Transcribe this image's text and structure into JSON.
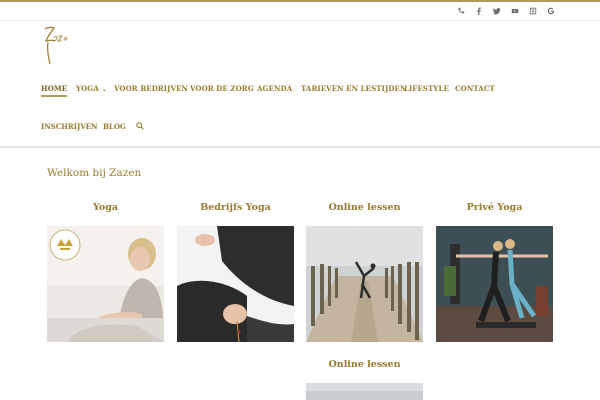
{
  "header": {
    "social_icons": [
      "phone-icon",
      "facebook-icon",
      "twitter-icon",
      "youtube-icon",
      "instagram-icon",
      "google-icon"
    ],
    "accent_color": "#b6985d",
    "logo_text": "Zazen"
  },
  "nav": {
    "items": [
      {
        "label": "HOME",
        "active": true
      },
      {
        "label": "YOGA",
        "has_dropdown": true
      },
      {
        "label": "VOOR BEDRIJVEN"
      },
      {
        "label": "VOOR DE ZORG"
      },
      {
        "label": "AGENDA"
      },
      {
        "label": "TARIEVEN EN LESTIJDEN"
      },
      {
        "label": "LIFESTYLE"
      },
      {
        "label": "CONTACT"
      },
      {
        "label": "INSCHRIJVEN"
      },
      {
        "label": "BLOG"
      }
    ],
    "search_icon": "search-icon"
  },
  "main": {
    "welcome": "Welkom bij Zazen",
    "cards": [
      {
        "title": "Yoga"
      },
      {
        "title": "Bedrijfs Yoga"
      },
      {
        "title": "Online lessen"
      },
      {
        "title": "Privé Yoga"
      }
    ],
    "second_row": [
      {
        "title": "Online lessen"
      }
    ]
  }
}
